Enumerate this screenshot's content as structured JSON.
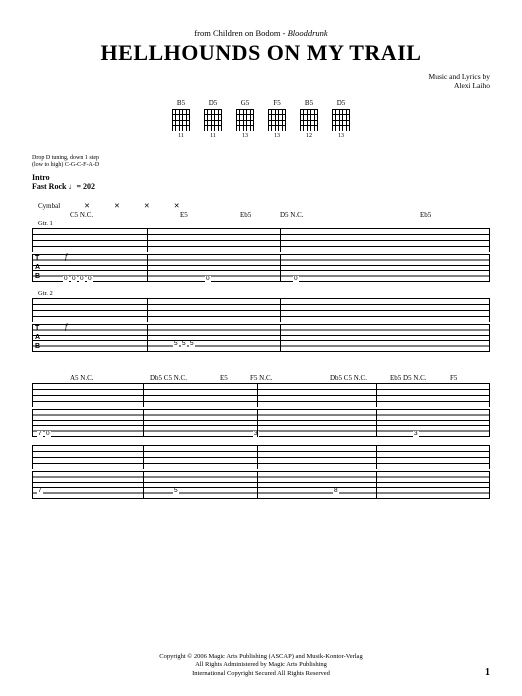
{
  "source_prefix": "from Children on Bodom - ",
  "source_album": "Blooddrunk",
  "title": "HELLHOUNDS ON MY TRAIL",
  "credits_line1": "Music and Lyrics by",
  "credits_line2": "Alexi Laiho",
  "chord_diagrams": [
    {
      "name": "B5",
      "fret": "11"
    },
    {
      "name": "D5",
      "fret": "11"
    },
    {
      "name": "G5",
      "fret": "13"
    },
    {
      "name": "F5",
      "fret": "13"
    },
    {
      "name": "B5",
      "fret": "12"
    },
    {
      "name": "D5",
      "fret": "13"
    }
  ],
  "tuning_line1": "Drop D tuning, down 1 step",
  "tuning_line2": "(low to high) C-G-C-F-A-D",
  "section_label": "Intro",
  "tempo_label": "Fast Rock ♩= 202",
  "cymbal_label": "Cymbal",
  "gtr1_label": "Gtr. 1",
  "gtr2_label": "Gtr. 2",
  "dynamic": "f",
  "tab_label_T": "T",
  "tab_label_A": "A",
  "tab_label_B": "B",
  "system1_chords": [
    "C5 N.C.",
    "E5",
    "Eb5",
    "D5 N.C.",
    "Eb5"
  ],
  "system2_chords": [
    "A5 N.C.",
    "Db5 C5 N.C.",
    "E5",
    "F5 N.C.",
    "Db5 C5 N.C.",
    "Eb5 D5 N.C.",
    "F5"
  ],
  "tab_fret_low": "0",
  "tab_fret_3": "3",
  "tab_fret_5": "5",
  "tab_fret_7": "7",
  "tab_fret_8": "8",
  "copyright_line1": "Copyright © 2006 Magic Arts Publishing (ASCAP) and Musik-Kontor-Verlag",
  "copyright_line2": "All Rights Administered by Magic Arts Publishing",
  "copyright_line3": "International Copyright Secured   All Rights Reserved",
  "page_number": "1"
}
